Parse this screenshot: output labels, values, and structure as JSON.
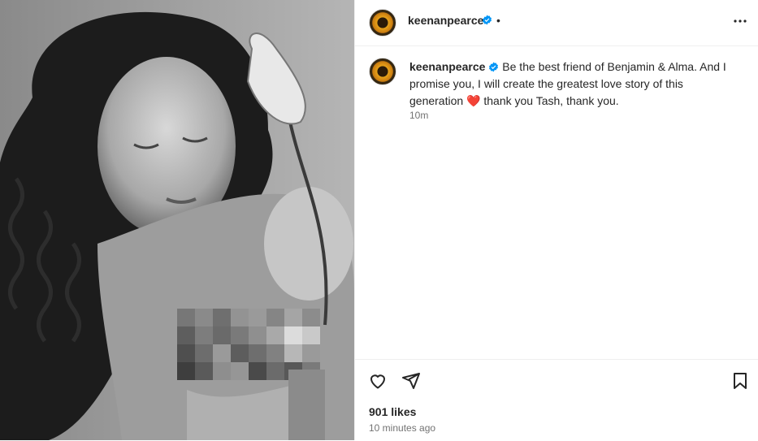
{
  "post": {
    "username": "keenanpearce",
    "header_dot": "•",
    "caption": "Be the best friend of Benjamin & Alma. And I promise you, I will create the greatest love story of this generation ❤️ thank you Tash, thank you.",
    "caption_time": "10m",
    "likes": "901 likes",
    "time_ago": "10 minutes ago",
    "image": "black-and-white photo of a woman with curly hair holding a lotus flower"
  },
  "icons": {
    "more": "more-options-icon",
    "like": "heart-icon",
    "share": "paper-plane-icon",
    "save": "bookmark-icon",
    "verified": "verified-badge-icon"
  },
  "colors": {
    "verified": "#0095f6",
    "text": "#262626",
    "muted": "#737373",
    "heart": "#ed4956"
  }
}
